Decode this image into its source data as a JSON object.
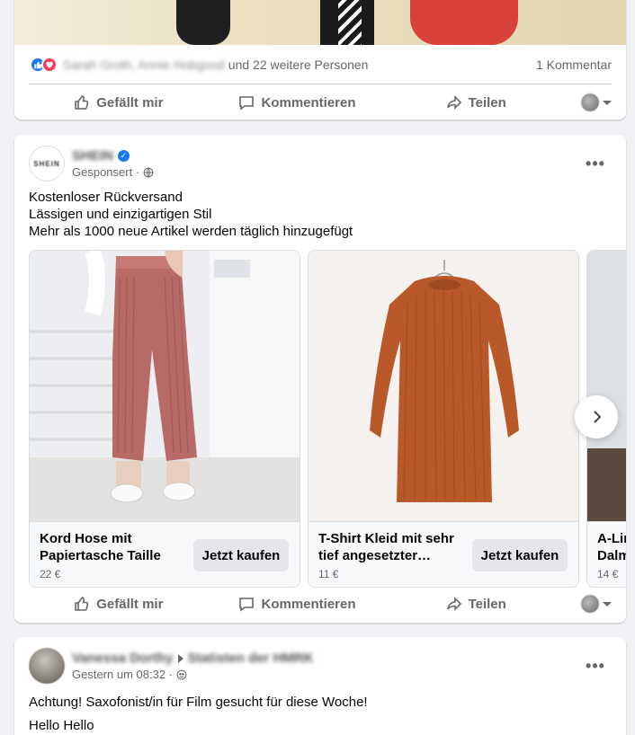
{
  "post1": {
    "reaction_names": "Sarah Groth, Annie Hobgood",
    "others_text": "und 22 weitere Personen",
    "comments_text": "1 Kommentar",
    "actions": {
      "like": "Gefällt mir",
      "comment": "Kommentieren",
      "share": "Teilen"
    }
  },
  "post2": {
    "page_name": "SHEIN",
    "avatar_text": "SHEIN",
    "sponsored_text": "Gesponsert ·",
    "text_lines": [
      "Kostenloser Rückversand",
      "Lässigen und einzigartigen Stil",
      "Mehr als 1000 neue Artikel werden täglich hinzugefügt"
    ],
    "products": [
      {
        "title": "Kord Hose mit Papiertasche Taille",
        "price": "22 €",
        "button": "Jetzt kaufen"
      },
      {
        "title": "T-Shirt Kleid mit sehr tief angesetzter…",
        "price": "11 €",
        "button": "Jetzt kaufen"
      },
      {
        "title": "A-Lin Dalm",
        "price": "14 €"
      }
    ],
    "actions": {
      "like": "Gefällt mir",
      "comment": "Kommentieren",
      "share": "Teilen"
    }
  },
  "post3": {
    "author_name": "Vanessa Dorthy",
    "group_name": "Statisten der HMRK",
    "time_text": "Gestern um 08:32 ·",
    "text_lines": [
      "Achtung! Saxofonist/in für Film gesucht für diese Woche!",
      "Hello Hello"
    ]
  },
  "colors": {
    "accent": "#1877f2",
    "love": "#f33e58",
    "secondary_text": "#65676b",
    "background": "#f0f2f5"
  }
}
